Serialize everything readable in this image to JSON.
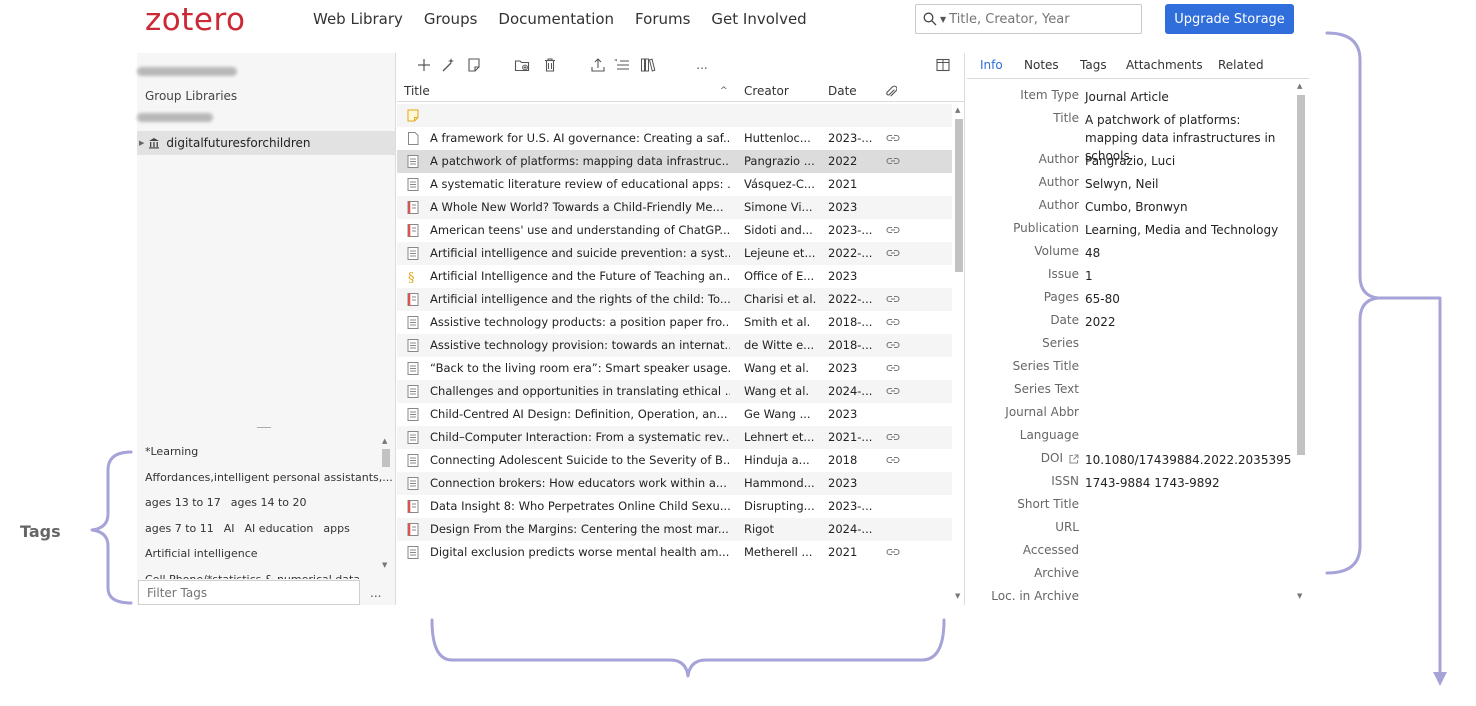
{
  "brand": {
    "logo": "zotero",
    "accent": "#cc2936",
    "button_color": "#2f6edb"
  },
  "nav": [
    "Web Library",
    "Groups",
    "Documentation",
    "Forums",
    "Get Involved"
  ],
  "search": {
    "placeholder": "Title, Creator, Year",
    "icon": "search-icon"
  },
  "upgrade_button": "Upgrade Storage",
  "left_pane": {
    "group_libraries_label": "Group Libraries",
    "collection": "digitalfuturesforchildren"
  },
  "tags": {
    "lines": [
      [
        "*Learning"
      ],
      [
        "Affordances,intelligent personal assistants,..."
      ],
      [
        "ages 13 to 17",
        "ages 14 to 20"
      ],
      [
        "ages 7 to 11",
        "AI",
        "AI education",
        "apps"
      ],
      [
        "Artificial intelligence"
      ],
      [
        "Cell Phone/*statistics & numerical data"
      ]
    ],
    "filter_placeholder": "Filter Tags",
    "more": "..."
  },
  "toolbar": {
    "icons": [
      "new-item-icon",
      "magic-wand-icon",
      "new-note-icon",
      "add-to-collection-icon",
      "trash-icon",
      "export-icon",
      "cite-icon",
      "library-bookshelf-icon",
      "more-icon",
      "columns-icon"
    ],
    "more_label": "..."
  },
  "columns": {
    "title": "Title",
    "creator": "Creator",
    "date": "Date",
    "sort_indicator": "^"
  },
  "items": [
    {
      "icon": "note",
      "title": "",
      "creator": "",
      "date": "",
      "attach": false
    },
    {
      "icon": "doc",
      "title": "A framework for U.S. AI governance: Creating a saf...",
      "creator": "Huttenloc...",
      "date": "2023-...",
      "attach": true
    },
    {
      "icon": "article",
      "title": "A patchwork of platforms: mapping data infrastruc...",
      "creator": "Pangrazio ...",
      "date": "2022",
      "attach": true
    },
    {
      "icon": "article",
      "title": "A systematic literature review of educational apps: ...",
      "creator": "Vásquez-C...",
      "date": "2021",
      "attach": false
    },
    {
      "icon": "report",
      "title": "A Whole New World? Towards a Child-Friendly Me...",
      "creator": "Simone Vi...",
      "date": "2023",
      "attach": false
    },
    {
      "icon": "report",
      "title": "American teens' use and understanding of ChatGP...",
      "creator": "Sidoti and...",
      "date": "2023-...",
      "attach": true
    },
    {
      "icon": "article",
      "title": "Artificial intelligence and suicide prevention: a syst...",
      "creator": "Lejeune et...",
      "date": "2022-...",
      "attach": true
    },
    {
      "icon": "legal",
      "title": "Artificial Intelligence and the Future of Teaching an...",
      "creator": "Office of E...",
      "date": "2023",
      "attach": false
    },
    {
      "icon": "report",
      "title": "Artificial intelligence and the rights of the child: To...",
      "creator": "Charisi et al.",
      "date": "2022-...",
      "attach": true
    },
    {
      "icon": "article",
      "title": "Assistive technology products: a position paper fro...",
      "creator": "Smith et al.",
      "date": "2018-...",
      "attach": true
    },
    {
      "icon": "article",
      "title": "Assistive technology provision: towards an internat...",
      "creator": "de Witte e...",
      "date": "2018-...",
      "attach": true
    },
    {
      "icon": "article",
      "title": "“Back to the living room era”: Smart speaker usage...",
      "creator": "Wang et al.",
      "date": "2023",
      "attach": true
    },
    {
      "icon": "article",
      "title": "Challenges and opportunities in translating ethical ...",
      "creator": "Wang et al.",
      "date": "2024-...",
      "attach": true
    },
    {
      "icon": "article",
      "title": "Child-Centred AI Design: Definition, Operation, an...",
      "creator": "Ge Wang ...",
      "date": "2023",
      "attach": false
    },
    {
      "icon": "article",
      "title": "Child–Computer Interaction: From a systematic rev...",
      "creator": "Lehnert et...",
      "date": "2021-...",
      "attach": true
    },
    {
      "icon": "article",
      "title": "Connecting Adolescent Suicide to the Severity of B...",
      "creator": "Hinduja a...",
      "date": "2018",
      "attach": true
    },
    {
      "icon": "article",
      "title": "Connection brokers: How educators work within a...",
      "creator": "Hammond...",
      "date": "2023",
      "attach": false
    },
    {
      "icon": "report",
      "title": "Data Insight 8: Who Perpetrates Online Child Sexu...",
      "creator": "Disrupting...",
      "date": "2023-...",
      "attach": false
    },
    {
      "icon": "report",
      "title": "Design From the Margins: Centering the most mar...",
      "creator": "Rigot",
      "date": "2024-...",
      "attach": false
    },
    {
      "icon": "article",
      "title": "Digital exclusion predicts worse mental health am...",
      "creator": "Metherell ...",
      "date": "2021",
      "attach": true
    }
  ],
  "selected_index": 2,
  "detail_tabs": [
    "Info",
    "Notes",
    "Tags",
    "Attachments",
    "Related"
  ],
  "info": [
    {
      "k": "Item Type",
      "v": "Journal Article"
    },
    {
      "k": "Title",
      "v": "A patchwork of platforms: mapping data infrastructures in schools"
    },
    {
      "k": "Author",
      "v": "Pangrazio, Luci"
    },
    {
      "k": "Author",
      "v": "Selwyn, Neil"
    },
    {
      "k": "Author",
      "v": "Cumbo, Bronwyn"
    },
    {
      "k": "Publication",
      "v": "Learning, Media and Technology"
    },
    {
      "k": "Volume",
      "v": "48"
    },
    {
      "k": "Issue",
      "v": "1"
    },
    {
      "k": "Pages",
      "v": "65-80"
    },
    {
      "k": "Date",
      "v": "2022"
    },
    {
      "k": "Series",
      "v": ""
    },
    {
      "k": "Series Title",
      "v": ""
    },
    {
      "k": "Series Text",
      "v": ""
    },
    {
      "k": "Journal Abbr",
      "v": ""
    },
    {
      "k": "Language",
      "v": ""
    },
    {
      "k": "DOI",
      "v": "10.1080/17439884.2022.2035395"
    },
    {
      "k": "ISSN",
      "v": "1743-9884 1743-9892"
    },
    {
      "k": "Short Title",
      "v": ""
    },
    {
      "k": "URL",
      "v": ""
    },
    {
      "k": "Accessed",
      "v": ""
    },
    {
      "k": "Archive",
      "v": ""
    },
    {
      "k": "Loc. in Archive",
      "v": ""
    }
  ],
  "annotation": {
    "label": "Tags",
    "color": "#a6a3d8"
  }
}
